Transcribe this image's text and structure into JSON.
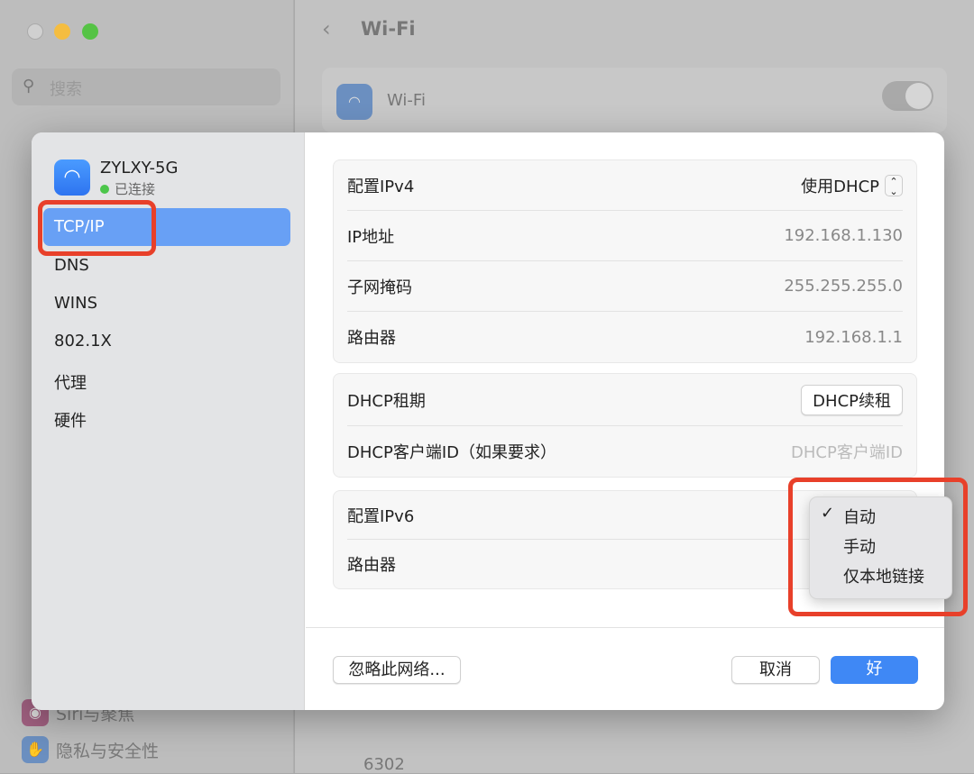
{
  "window": {
    "title": "Wi-Fi",
    "search_placeholder": "搜索",
    "wifi_label": "Wi-Fi",
    "sidebar_items": [
      "Siri与聚焦",
      "隐私与安全性"
    ],
    "networks": [
      "6302"
    ]
  },
  "dialog": {
    "network_name": "ZYLXY-5G",
    "network_status": "已连接",
    "nav": [
      "TCP/IP",
      "DNS",
      "WINS",
      "802.1X",
      "代理",
      "硬件"
    ],
    "ipv4": {
      "config_label": "配置IPv4",
      "config_value": "使用DHCP",
      "ip_label": "IP地址",
      "ip_value": "192.168.1.130",
      "mask_label": "子网掩码",
      "mask_value": "255.255.255.0",
      "router_label": "路由器",
      "router_value": "192.168.1.1"
    },
    "dhcp": {
      "lease_label": "DHCP租期",
      "renew_button": "DHCP续租",
      "client_id_label": "DHCP客户端ID（如果要求）",
      "client_id_placeholder": "DHCP客户端ID"
    },
    "ipv6": {
      "config_label": "配置IPv6",
      "router_label": "路由器"
    },
    "ipv6_menu": {
      "check": "✓",
      "options": [
        "自动",
        "手动",
        "仅本地链接"
      ],
      "selected": "自动"
    },
    "forget_button": "忽略此网络...",
    "cancel_button": "取消",
    "ok_button": "好"
  },
  "colors": {
    "accent": "#3b82f6",
    "highlight": "#e8402a",
    "selected_nav": "#68a0f5"
  }
}
